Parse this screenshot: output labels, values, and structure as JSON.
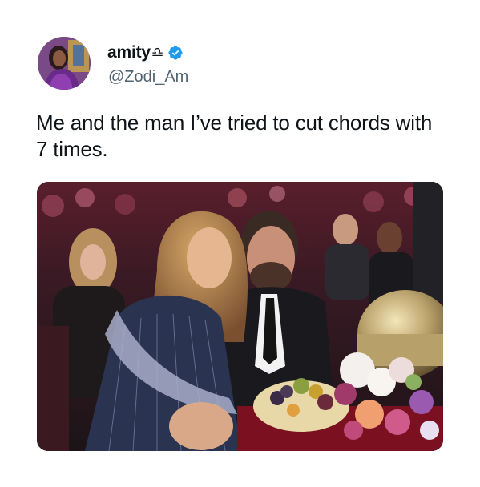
{
  "tweet": {
    "display_name": "amity",
    "name_symbol": "♎︎",
    "handle": "@Zodi_Am",
    "verified": true,
    "text": "Me and the man I’ve tried to cut chords with 7 times."
  },
  "icons": {
    "verified": "verified-badge-icon",
    "avatar": "profile-avatar"
  },
  "colors": {
    "verified_blue": "#1d9bf0",
    "handle_gray": "#536471",
    "text": "#0f1419"
  }
}
